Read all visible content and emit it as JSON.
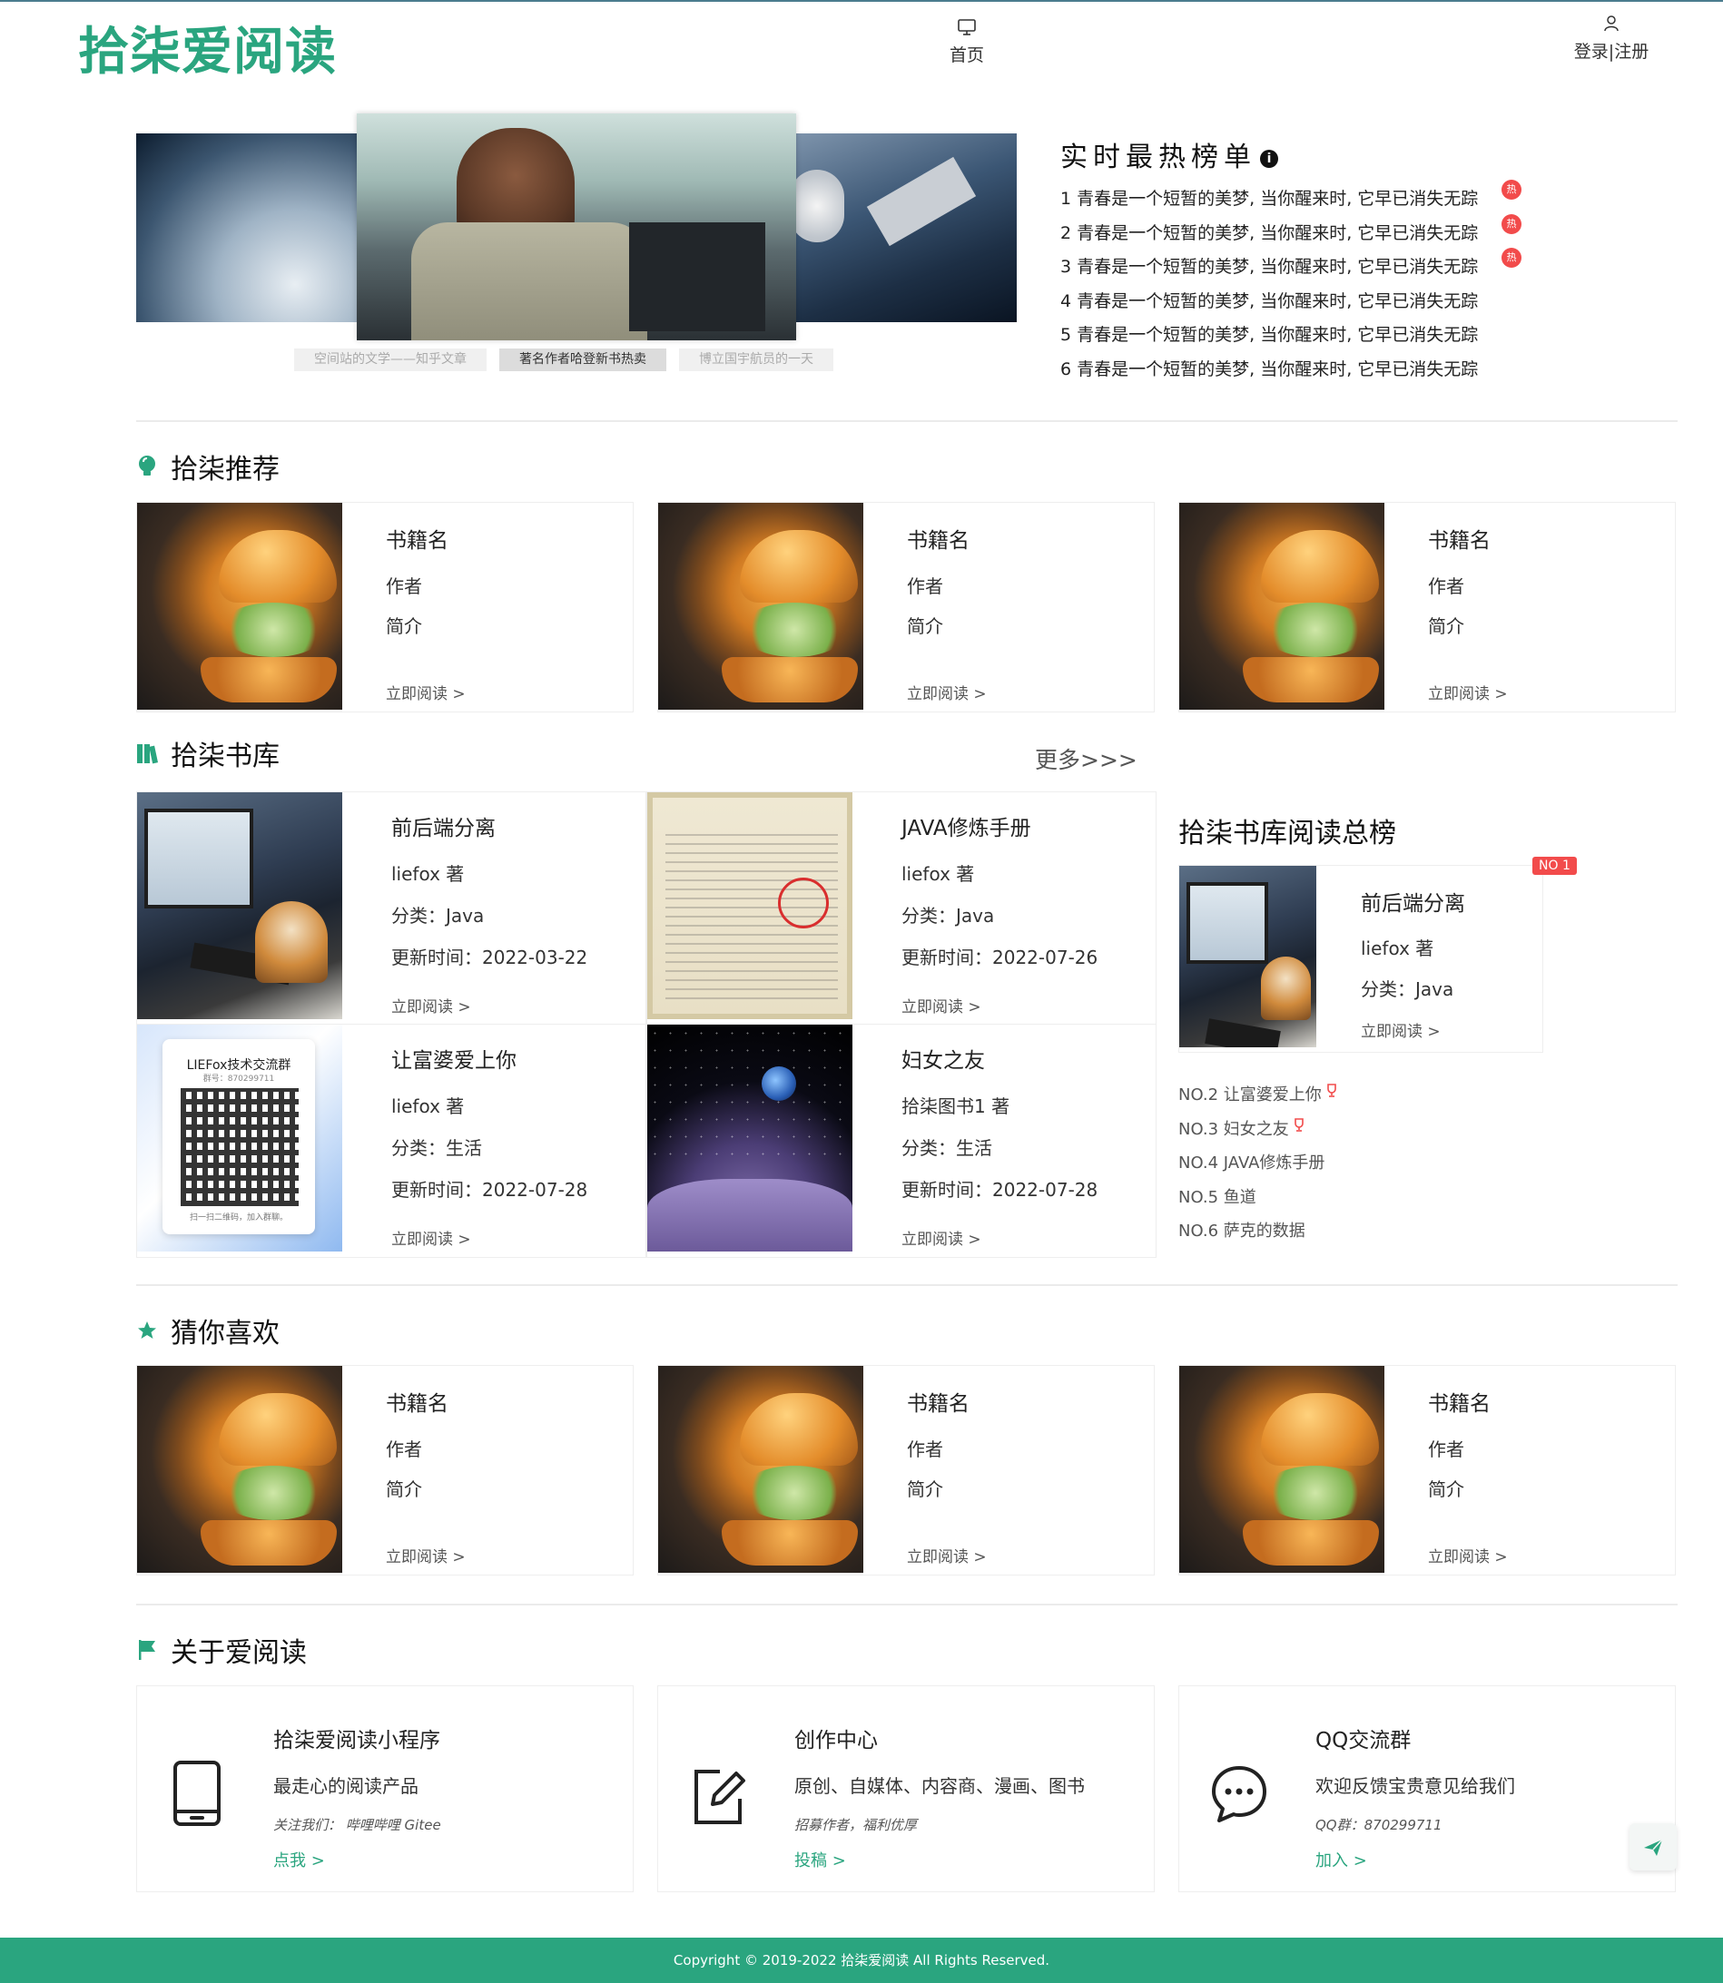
{
  "header": {
    "logo": "拾柒爱阅读",
    "nav_home": "首页",
    "nav_login": "登录|注册"
  },
  "carousel": {
    "tabs": [
      "空间站的文学——知乎文章",
      "著名作者哈登新书热卖",
      "博立国宇航员的一天"
    ]
  },
  "hot": {
    "title": "实时最热榜单",
    "info_icon": "i",
    "badge": "热",
    "items": [
      "1 青春是一个短暂的美梦, 当你醒来时, 它早已消失无踪",
      "2 青春是一个短暂的美梦, 当你醒来时, 它早已消失无踪",
      "3 青春是一个短暂的美梦, 当你醒来时, 它早已消失无踪",
      "4 青春是一个短暂的美梦, 当你醒来时, 它早已消失无踪",
      "5 青春是一个短暂的美梦, 当你醒来时, 它早已消失无踪",
      "6 青春是一个短暂的美梦, 当你醒来时, 它早已消失无踪"
    ]
  },
  "recommend": {
    "title": "拾柒推荐",
    "cards": [
      {
        "name": "书籍名",
        "author": "作者",
        "intro": "简介",
        "read": "立即阅读 >"
      },
      {
        "name": "书籍名",
        "author": "作者",
        "intro": "简介",
        "read": "立即阅读 >"
      },
      {
        "name": "书籍名",
        "author": "作者",
        "intro": "简介",
        "read": "立即阅读 >"
      }
    ]
  },
  "library": {
    "title": "拾柒书库",
    "more": "更多>>>",
    "qq_image": {
      "title": "LIEFox技术交流群",
      "sub": "群号：870299711",
      "foot": "扫一扫二维码，加入群聊。"
    },
    "books": [
      {
        "name": "前后端分离",
        "author": "liefox 著",
        "category": "分类：Java",
        "updated": "更新时间：2022-03-22",
        "read": "立即阅读 >"
      },
      {
        "name": "JAVA修炼手册",
        "author": "liefox 著",
        "category": "分类：Java",
        "updated": "更新时间：2022-07-26",
        "read": "立即阅读 >"
      },
      {
        "name": "让富婆爱上你",
        "author": "liefox 著",
        "category": "分类：生活",
        "updated": "更新时间：2022-07-28",
        "read": "立即阅读 >"
      },
      {
        "name": "妇女之友",
        "author": "拾柒图书1 著",
        "category": "分类：生活",
        "updated": "更新时间：2022-07-28",
        "read": "立即阅读 >"
      }
    ]
  },
  "ranking": {
    "title": "拾柒书库阅读总榜",
    "no1_badge": "NO 1",
    "top": {
      "name": "前后端分离",
      "author": "liefox 著",
      "category": "分类：Java",
      "read": "立即阅读 >"
    },
    "list": [
      "NO.2 让富婆爱上你",
      "NO.3 妇女之友",
      "NO.4 JAVA修炼手册",
      "NO.5 鱼道",
      "NO.6 萨克的数据"
    ]
  },
  "guess": {
    "title": "猜你喜欢",
    "cards": [
      {
        "name": "书籍名",
        "author": "作者",
        "intro": "简介",
        "read": "立即阅读 >"
      },
      {
        "name": "书籍名",
        "author": "作者",
        "intro": "简介",
        "read": "立即阅读 >"
      },
      {
        "name": "书籍名",
        "author": "作者",
        "intro": "简介",
        "read": "立即阅读 >"
      }
    ]
  },
  "about": {
    "title": "关于爱阅读",
    "cards": [
      {
        "title": "拾柒爱阅读小程序",
        "desc": "最走心的阅读产品",
        "sub": "关注我们：  哔哩哔哩 Gitee",
        "link": "点我 >"
      },
      {
        "title": "创作中心",
        "desc": "原创、自媒体、内容商、漫画、图书",
        "sub": "招募作者，福利优厚",
        "link": "投稿 >"
      },
      {
        "title": "QQ交流群",
        "desc": "欢迎反馈宝贵意见给我们",
        "sub": "QQ群：870299711",
        "link": "加入 >"
      }
    ]
  },
  "footer": {
    "text": "Copyright © 2019-2022 拾柒爱阅读 All Rights Reserved."
  },
  "colors": {
    "brand": "#2aa57f",
    "hot_badge": "#f24b4b"
  }
}
